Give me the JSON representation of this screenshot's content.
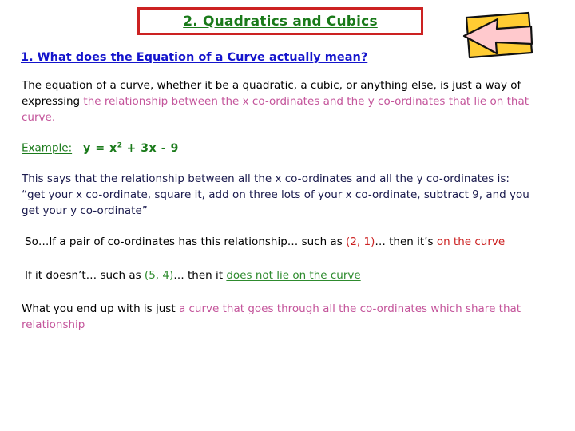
{
  "slide": {
    "title": "2. Quadratics and Cubics",
    "colors": {
      "title_text": "#1A7A1A",
      "title_border": "#CC2222",
      "heading": "#1414CC",
      "magenta": "#C4559B",
      "red": "#CC2222",
      "green": "#2E8B2E",
      "navy": "#1A1A4D",
      "arrow_fill": "#FFCC33",
      "arrow_head": "#FFC9CD",
      "background": "#FFFFFF"
    },
    "clipart": {
      "name": "left-arrow-clipart"
    },
    "heading": "1. What does the Equation of a Curve actually mean?",
    "intro": {
      "black": "The equation of a curve, whether it be a quadratic, a cubic, or anything else, is just a way of expressing ",
      "magenta": "the relationship between the x co-ordinates and the y co-ordinates that lie on that curve."
    },
    "example": {
      "label": "Example:",
      "equation_lhs": "y = x",
      "equation_sup": "2",
      "equation_rhs": " + 3x - 9"
    },
    "says": {
      "line1": "This says that the relationship between all the x co-ordinates and all the y co-ordinates is:",
      "line2": "“get your x co-ordinate, square it, add on three lots of your x co-ordinate, subtract 9, and you get your y co-ordinate”"
    },
    "so_line": {
      "part1": "So…If a pair of co-ordinates has this relationship… such as ",
      "coords": "(2, 1)",
      "part2": "… then it’s ",
      "emphasis": "on the curve"
    },
    "if_line": {
      "part1": "If it doesn’t… such as ",
      "coords": "(5, 4)",
      "part2": "… then it ",
      "emphasis": "does not lie on the curve"
    },
    "what_line": {
      "black": "What you end up with is just ",
      "magenta": "a curve that goes through all the co-ordinates which share that relationship"
    }
  }
}
